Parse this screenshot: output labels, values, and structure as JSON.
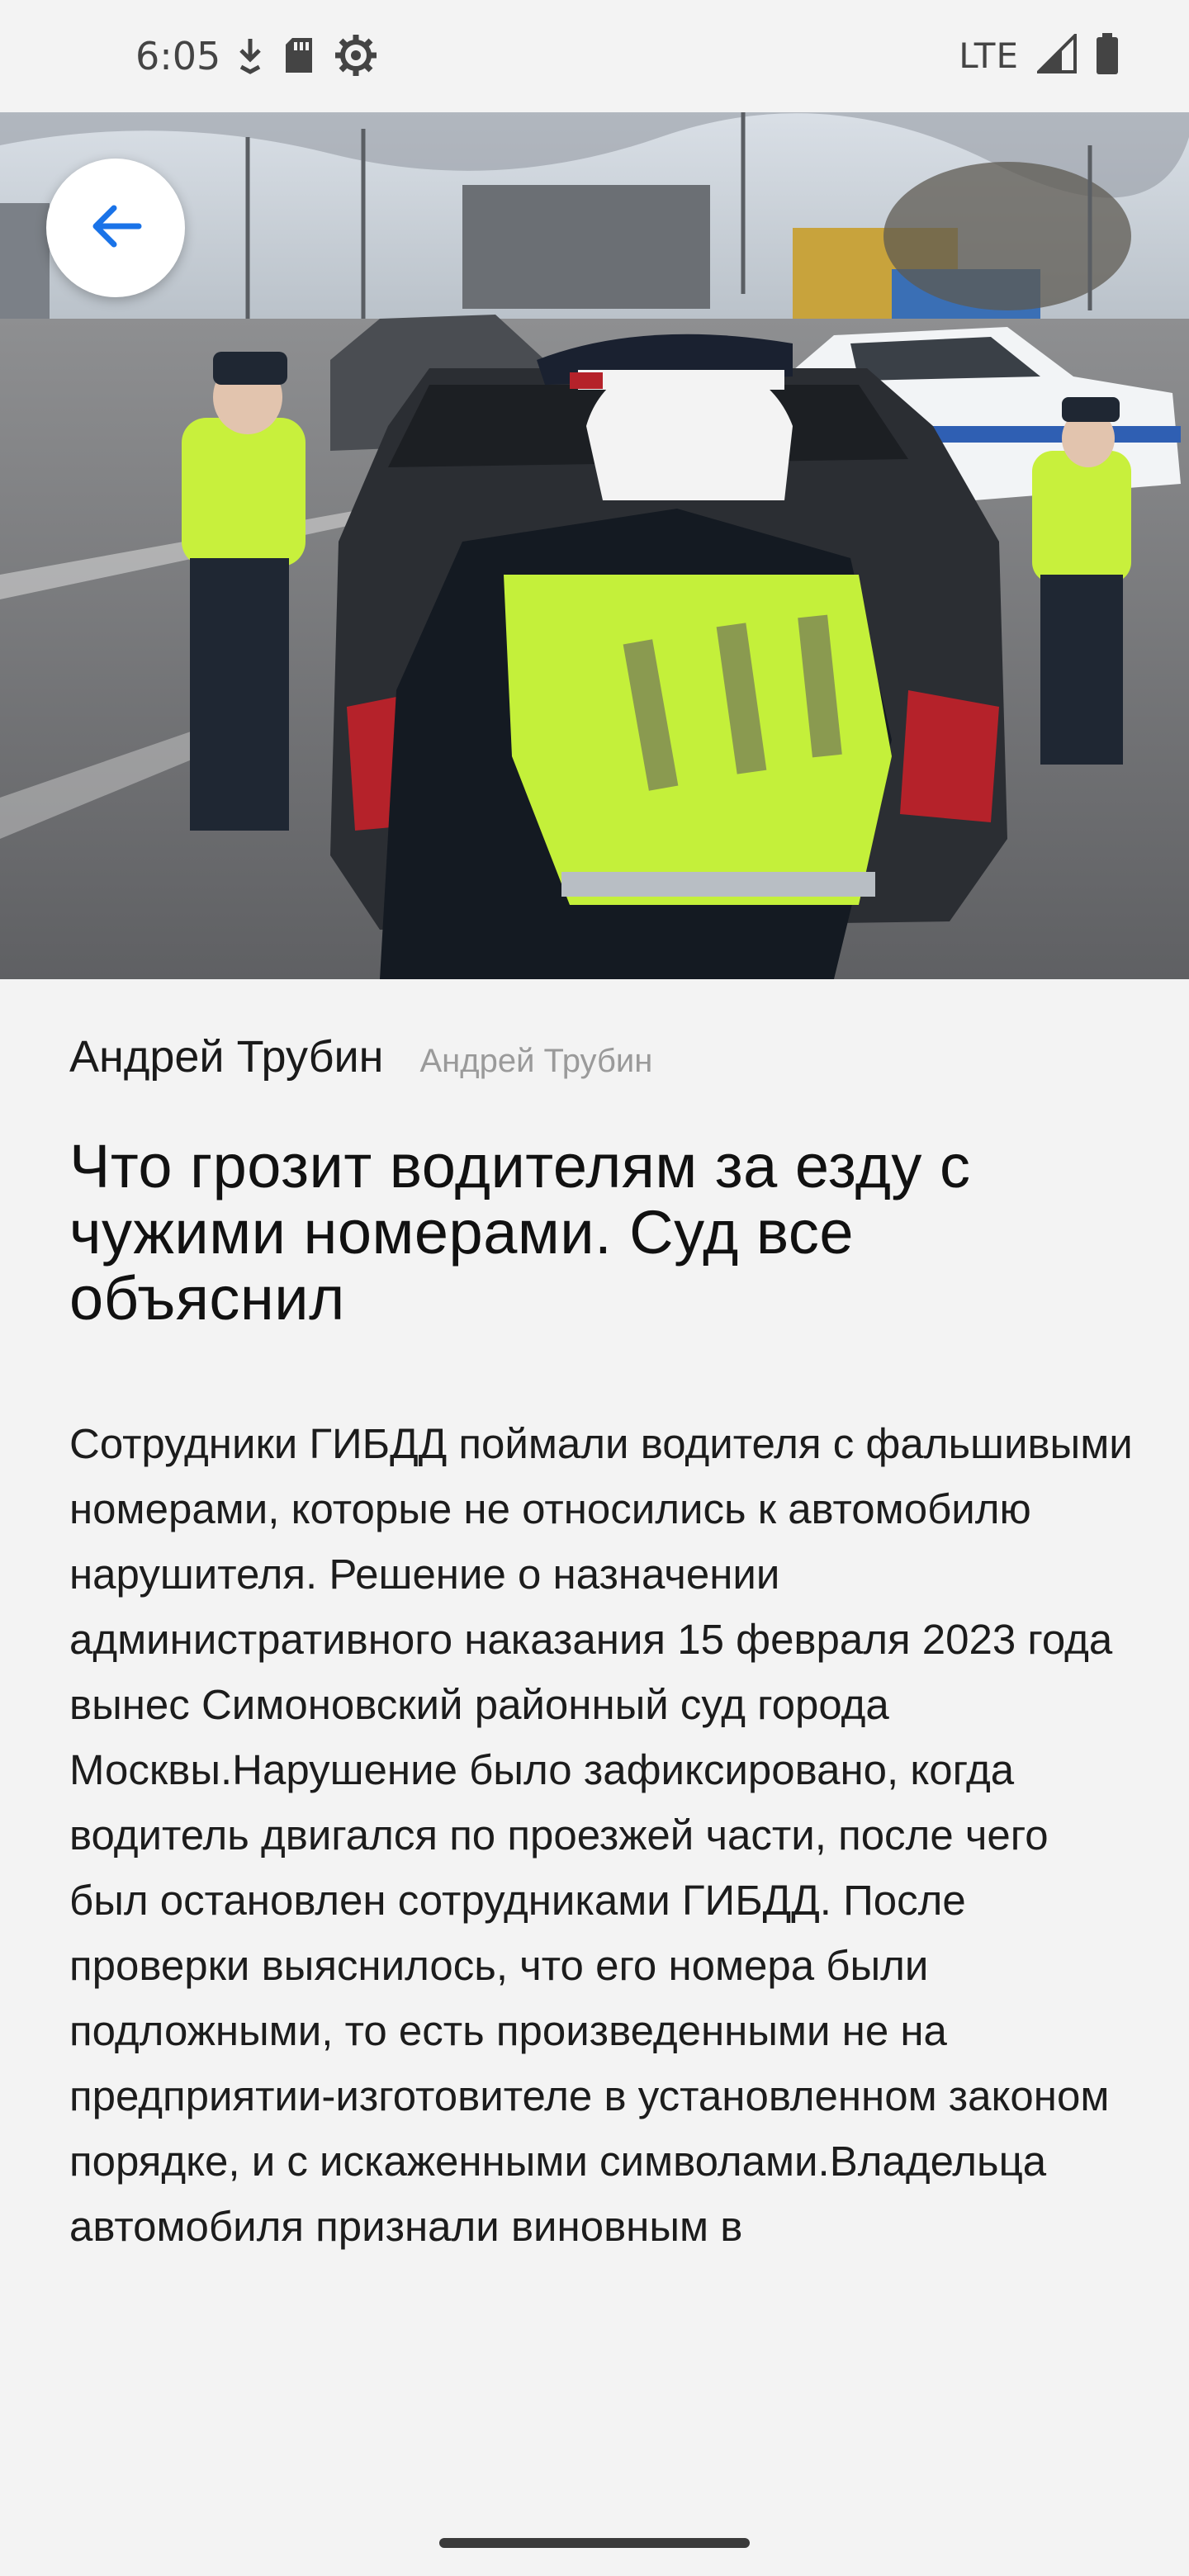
{
  "status_bar": {
    "time": "6:05",
    "network": "LTE",
    "icons_left": [
      "download-icon",
      "sd-card-icon",
      "settings-icon"
    ],
    "icons_right": [
      "signal-icon",
      "battery-icon"
    ]
  },
  "hero": {
    "back_icon": "arrow-left-icon",
    "accent_color": "#1a73e8"
  },
  "article": {
    "author": "Андрей Трубин",
    "author_secondary": "Андрей Трубин",
    "title": "Что грозит водителям за езду с чужими номерами. Суд все объяснил",
    "body": "Сотрудники ГИБДД поймали водителя с фальшивыми номерами, которые не относились к автомобилю нарушителя. Решение о назначении административного наказания 15 февраля 2023 года вынес Симоновский районный суд города Москвы.Нарушение было зафиксировано, когда водитель двигался по проезжей части, после чего был остановлен сотрудниками ГИБДД. После проверки выяснилось, что его номера были подложными, то есть произведенными не на предприятии-изготовителе в установленном законом порядке, и с искаженными символами.Владельца автомобиля признали виновным в"
  }
}
